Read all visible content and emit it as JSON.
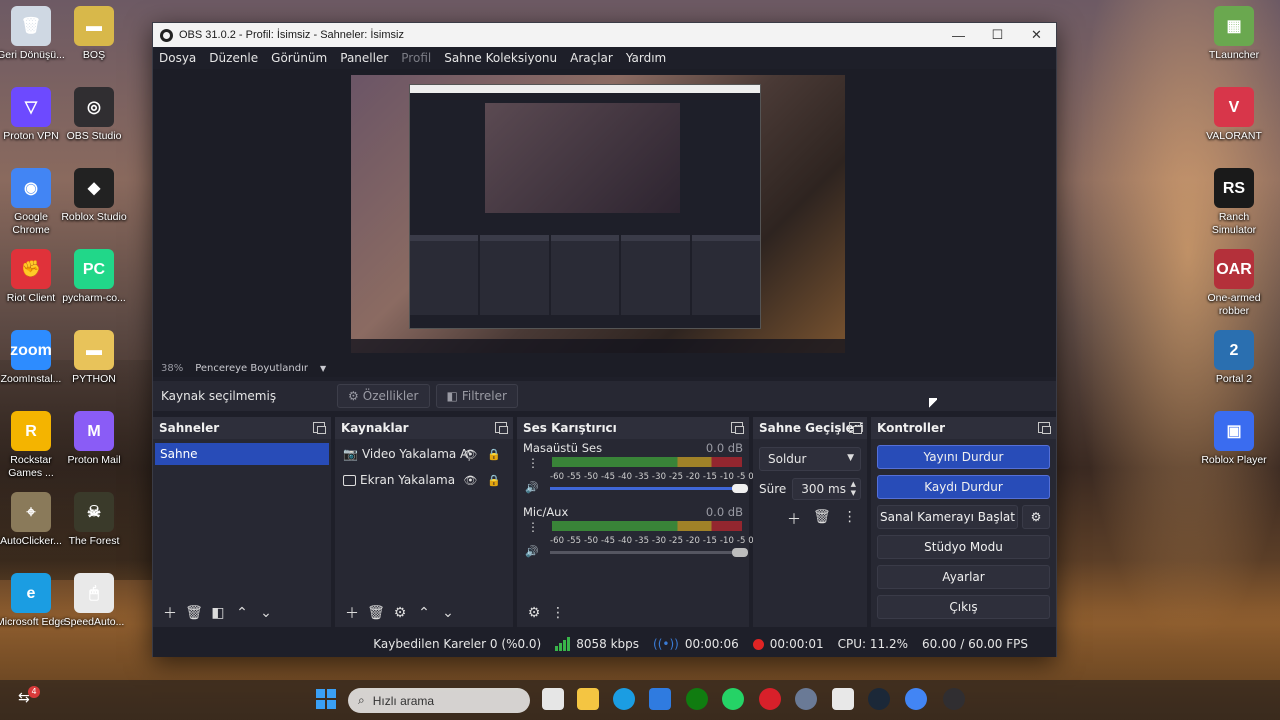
{
  "desktop": {
    "icons_left": [
      {
        "label": "Geri Dönüşü...",
        "color": "#cfd8e3",
        "glyph": "🗑"
      },
      {
        "label": "Proton VPN",
        "color": "#6d4aff",
        "glyph": "▽"
      },
      {
        "label": "Google Chrome",
        "color": "#4285f4",
        "glyph": "◉"
      },
      {
        "label": "Riot Client",
        "color": "#e0323a",
        "glyph": "✊"
      },
      {
        "label": "ZoomInstal...",
        "color": "#2d8cff",
        "glyph": "zoom"
      },
      {
        "label": "Rockstar Games ...",
        "color": "#f4b400",
        "glyph": "R"
      },
      {
        "label": "AutoClicker...",
        "color": "#8a7a5a",
        "glyph": "⌖"
      },
      {
        "label": "Microsoft Edge",
        "color": "#1b9de2",
        "glyph": "e"
      }
    ],
    "icons_col2": [
      {
        "label": "BOŞ",
        "color": "#d8b84a",
        "glyph": "▬"
      },
      {
        "label": "OBS Studio",
        "color": "#302e31",
        "glyph": "◎"
      },
      {
        "label": "Roblox Studio",
        "color": "#222222",
        "glyph": "◆"
      },
      {
        "label": "pycharm-co...",
        "color": "#21d789",
        "glyph": "PC"
      },
      {
        "label": "PYTHON",
        "color": "#e8c35a",
        "glyph": "▬"
      },
      {
        "label": "Proton Mail",
        "color": "#8a5cf6",
        "glyph": "M"
      },
      {
        "label": "The Forest",
        "color": "#3a3a2a",
        "glyph": "☠"
      },
      {
        "label": "SpeedAuto...",
        "color": "#e9e9e9",
        "glyph": "🖱"
      }
    ],
    "icons_right": [
      {
        "label": "TLauncher",
        "color": "#6aa84f",
        "glyph": "▦"
      },
      {
        "label": "VALORANT",
        "color": "#d8364a",
        "glyph": "V"
      },
      {
        "label": "Ranch Simulator",
        "color": "#1a1a1a",
        "glyph": "RS"
      },
      {
        "label": "One-armed robber",
        "color": "#b4303a",
        "glyph": "OAR"
      },
      {
        "label": "Portal 2",
        "color": "#2a6fb0",
        "glyph": "2"
      },
      {
        "label": "Roblox Player",
        "color": "#3a6cf0",
        "glyph": "▣"
      }
    ]
  },
  "window": {
    "title": "OBS 31.0.2 - Profil: İsimsiz - Sahneler: İsimsiz",
    "controls": {
      "minimize": "—",
      "maximize": "☐",
      "close": "✕"
    }
  },
  "menu": [
    {
      "label": "Dosya",
      "enabled": true
    },
    {
      "label": "Düzenle",
      "enabled": true
    },
    {
      "label": "Görünüm",
      "enabled": true
    },
    {
      "label": "Paneller",
      "enabled": true
    },
    {
      "label": "Profil",
      "enabled": false
    },
    {
      "label": "Sahne Koleksiyonu",
      "enabled": true
    },
    {
      "label": "Araçlar",
      "enabled": true
    },
    {
      "label": "Yardım",
      "enabled": true
    }
  ],
  "preview": {
    "zoom": "38%",
    "scale_mode": "Pencereye Boyutlandır"
  },
  "source_toolbar": {
    "no_selection": "Kaynak seçilmemiş",
    "properties": "Özellikler",
    "filters": "Filtreler"
  },
  "scenes": {
    "title": "Sahneler",
    "items": [
      "Sahne"
    ]
  },
  "sources": {
    "title": "Kaynaklar",
    "items": [
      {
        "label": "Video Yakalama Aygıt"
      },
      {
        "label": "Ekran Yakalama"
      }
    ]
  },
  "mixer": {
    "title": "Ses Karıştırıcı",
    "ticks": "-60 -55 -50 -45 -40 -35 -30 -25 -20 -15 -10 -5  0",
    "channels": [
      {
        "name": "Masaüstü Ses",
        "db": "0.0 dB",
        "volume_percent": 100,
        "muted": false
      },
      {
        "name": "Mic/Aux",
        "db": "0.0 dB",
        "volume_percent": 100,
        "muted": true
      }
    ]
  },
  "transitions": {
    "title": "Sahne Geçişleri",
    "selected": "Soldur",
    "duration_label": "Süre",
    "duration_value": "300 ms"
  },
  "controls": {
    "title": "Kontroller",
    "stop_stream": "Yayını Durdur",
    "stop_record": "Kaydı Durdur",
    "virtual_cam": "Sanal Kamerayı Başlat",
    "studio_mode": "Stüdyo Modu",
    "settings": "Ayarlar",
    "exit": "Çıkış"
  },
  "status": {
    "dropped_frames": "Kaybedilen Kareler 0 (%0.0)",
    "bitrate": "8058 kbps",
    "stream_time": "00:00:06",
    "record_time": "00:00:01",
    "cpu": "CPU: 11.2%",
    "fps": "60.00 / 60.00 FPS",
    "colors": {
      "bitrate": "#39b54a",
      "stream": "#3a7bd5",
      "record": "#e02424"
    }
  },
  "taskbar": {
    "search_placeholder": "Hızlı arama",
    "notification_badge": "4"
  }
}
